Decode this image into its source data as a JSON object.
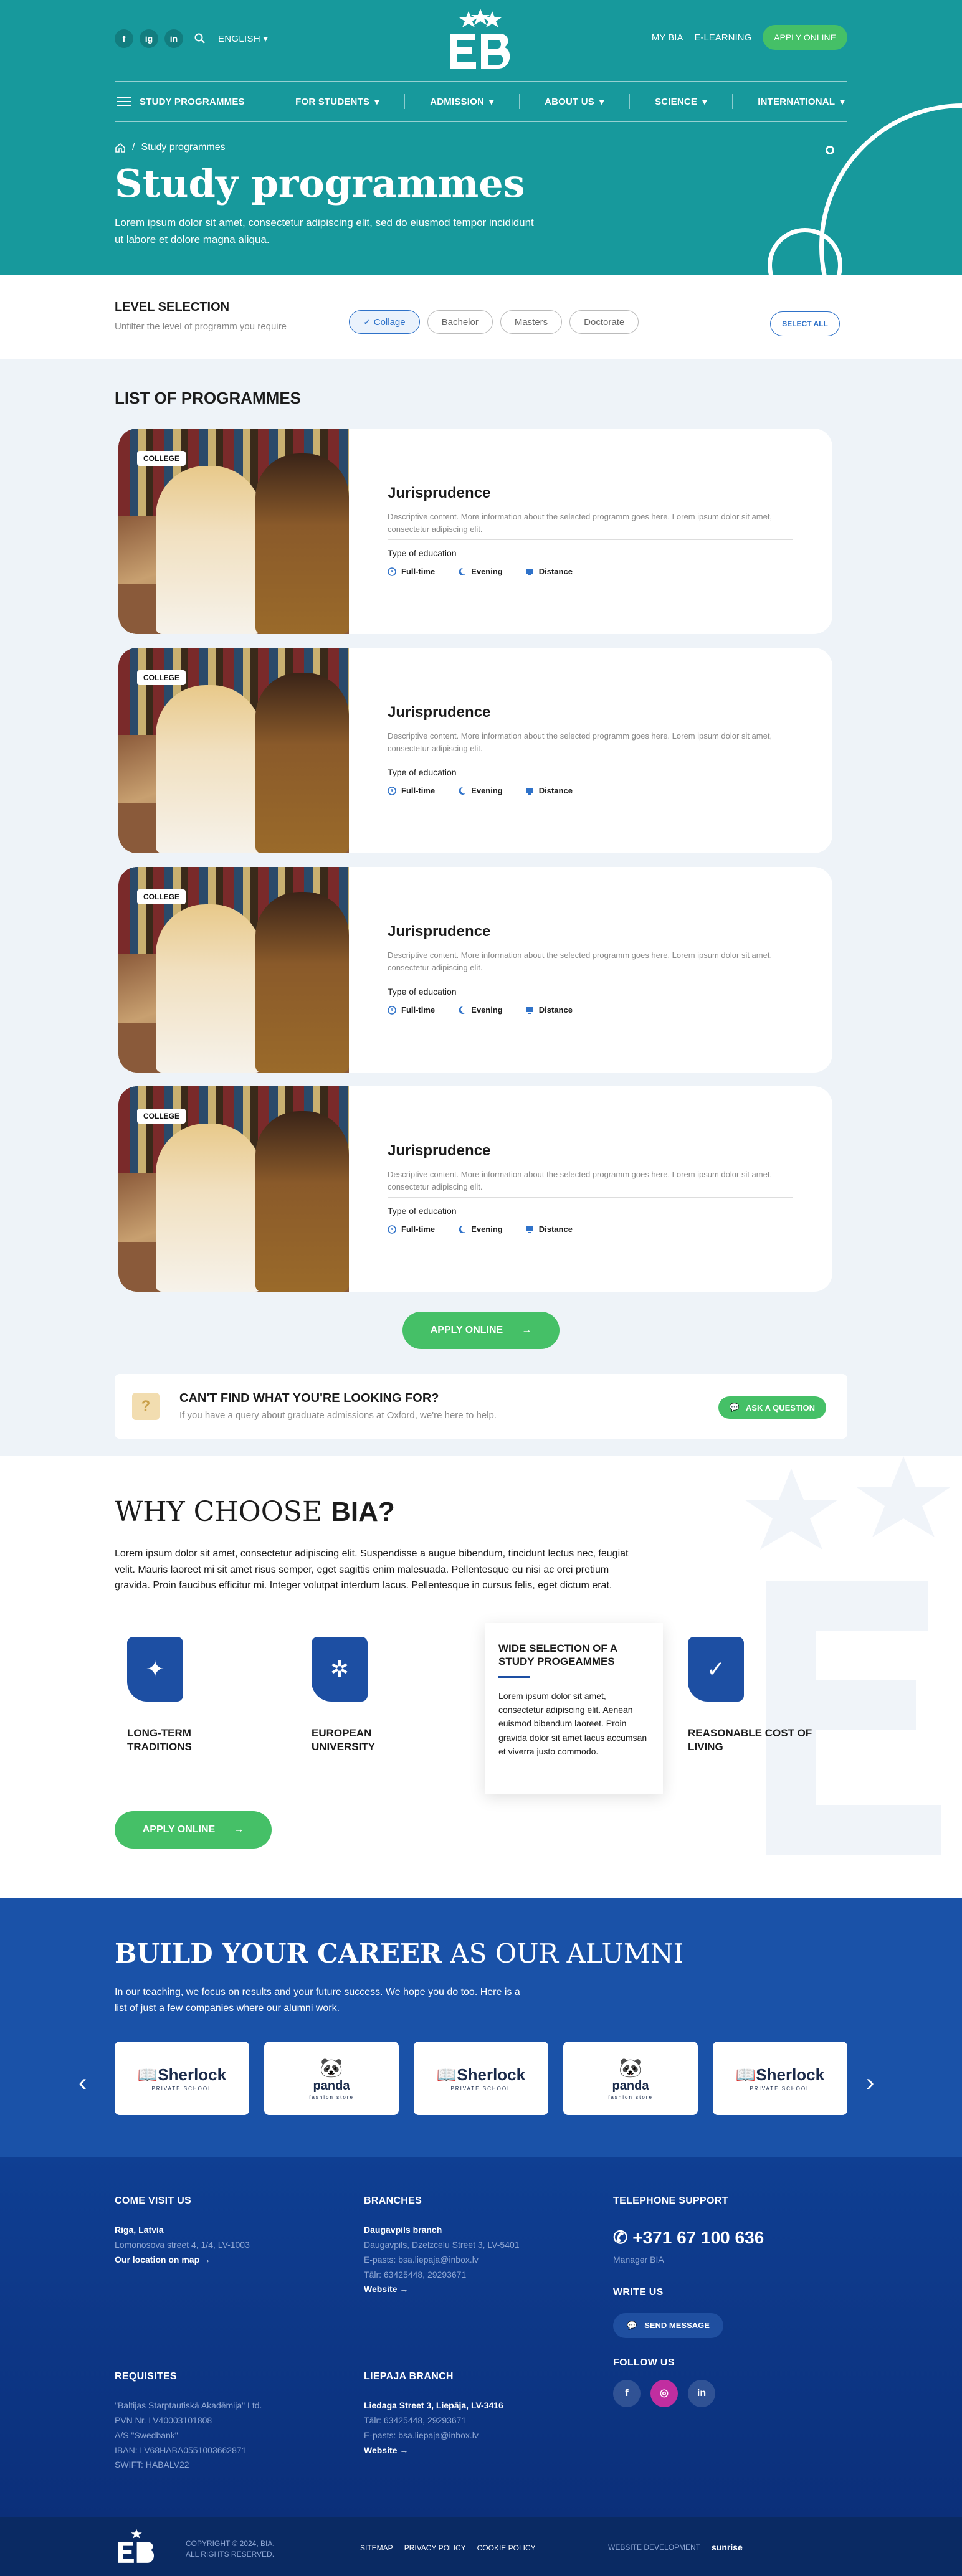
{
  "header": {
    "social": [
      "f",
      "ig",
      "in"
    ],
    "language": "ENGLISH",
    "links": [
      "MY BIA",
      "E-LEARNING"
    ],
    "apply": "APPLY ONLINE",
    "nav": [
      "STUDY PROGRAMMES",
      "FOR STUDENTS",
      "ADMISSION",
      "ABOUT US",
      "SCIENCE",
      "INTERNATIONAL"
    ],
    "breadcrumb": "Study programmes",
    "title": "Study programmes",
    "lead": "Lorem ipsum dolor sit amet, consectetur adipiscing elit, sed do eiusmod tempor incididunt ut labore et dolore magna aliqua."
  },
  "level": {
    "title": "LEVEL SELECTION",
    "subtitle": "Unfilter the level of programm you require",
    "chips": [
      "Collage",
      "Bachelor",
      "Masters",
      "Doctorate"
    ],
    "select_all": "SELECT ALL"
  },
  "list": {
    "title": "LIST OF PROGRAMMES",
    "cards": [
      {
        "badge": "COLLEGE",
        "title": "Jurisprudence",
        "desc": "Descriptive content. More information about the selected programm goes here. Lorem ipsum dolor sit amet, consectetur adipiscing elit.",
        "type_label": "Type of education",
        "types": [
          "Full-time",
          "Evening",
          "Distance"
        ]
      },
      {
        "badge": "COLLEGE",
        "title": "Jurisprudence",
        "desc": "Descriptive content. More information about the selected programm goes here. Lorem ipsum dolor sit amet, consectetur adipiscing elit.",
        "type_label": "Type of education",
        "types": [
          "Full-time",
          "Evening",
          "Distance"
        ]
      },
      {
        "badge": "COLLEGE",
        "title": "Jurisprudence",
        "desc": "Descriptive content. More information about the selected programm goes here. Lorem ipsum dolor sit amet, consectetur adipiscing elit.",
        "type_label": "Type of education",
        "types": [
          "Full-time",
          "Evening",
          "Distance"
        ]
      },
      {
        "badge": "COLLEGE",
        "title": "Jurisprudence",
        "desc": "Descriptive content. More information about the selected programm goes here. Lorem ipsum dolor sit amet, consectetur adipiscing elit.",
        "type_label": "Type of education",
        "types": [
          "Full-time",
          "Evening",
          "Distance"
        ]
      }
    ],
    "apply": "APPLY ONLINE",
    "question": {
      "title": "CAN'T FIND WHAT YOU'RE LOOKING FOR?",
      "subtitle": "If you have a query about graduate admissions at Oxford, we're here to help.",
      "button": "ASK A QUESTION"
    }
  },
  "why": {
    "title_light": "WHY CHOOSE ",
    "title_bold": "BIA?",
    "text": "Lorem ipsum dolor sit amet, consectetur adipiscing elit. Suspendisse a augue bibendum, tincidunt lectus nec, feugiat velit. Mauris laoreet mi sit amet risus semper, eget sagittis enim malesuada. Pellentesque eu nisi ac orci pretium gravida. Proin faucibus efficitur mi. Integer volutpat interdum lacus. Pellentesque in cursus felis, eget dictum erat.",
    "features": [
      "LONG-TERM TRADITIONS",
      "EUROPEAN UNIVERSITY",
      "REASONABLE COST OF LIVING"
    ],
    "card": {
      "title": "WIDE SELECTION OF A STUDY PROGEAMMES",
      "text": "Lorem ipsum dolor sit amet, consectetur adipiscing elit. Aenean euismod bibendum laoreet. Proin gravida dolor sit amet lacus accumsan et viverra justo commodo."
    },
    "apply": "APPLY ONLINE"
  },
  "career": {
    "title_bold": "BUILD YOUR CAREER",
    "title_light": " AS OUR ALUMNI",
    "text": "In our teaching, we focus on results and your future success. We hope you do too. Here is a list of just a few companies where our alumni work.",
    "partners": [
      {
        "name": "Sherlock",
        "tag": "PRIVATE SCHOOL"
      },
      {
        "name": "panda",
        "tag": "fashion store"
      },
      {
        "name": "Sherlock",
        "tag": "PRIVATE SCHOOL"
      },
      {
        "name": "panda",
        "tag": "fashion store"
      },
      {
        "name": "Sherlock",
        "tag": "PRIVATE SCHOOL"
      }
    ]
  },
  "footer": {
    "visit": {
      "title": "COME VISIT US",
      "city": "Riga, Latvia",
      "address": "Lomonosova street 4, 1/4, LV-1003",
      "map": "Our location on map"
    },
    "branches": {
      "title": "BRANCHES",
      "name": "Daugavpils branch",
      "address": "Daugavpils, Dzelzcelu Street 3, LV-5401",
      "email": "E-pasts: bsa.liepaja@inbox.lv",
      "tel": "Tālr: 63425448, 29293671",
      "website": "Website"
    },
    "support": {
      "title": "TELEPHONE SUPPORT",
      "phone": "+371 67 100 636",
      "manager": "Manager BIA",
      "write": "WRITE US",
      "send": "SEND MESSAGE",
      "follow": "FOLLOW US"
    },
    "requisites": {
      "title": "REQUISITES",
      "lines": [
        "\"Baltijas Starptautiskā Akadēmija\" Ltd.",
        "PVN Nr. LV40003101808",
        "A/S \"Swedbank\"",
        "IBAN: LV68HABA0551003662871",
        "SWIFT: HABALV22"
      ]
    },
    "liepaja": {
      "title": "LIEPAJA BRANCH",
      "address": "Liedaga Street 3, Liepāja, LV-3416",
      "tel": "Tālr: 63425448, 29293671",
      "email": "E-pasts: bsa.liepaja@inbox.lv",
      "website": "Website"
    }
  },
  "bottom": {
    "copy1": "COPYRIGHT © 2024, BIA.",
    "copy2": "ALL RIGHTS RESERVED.",
    "links": [
      "SITEMAP",
      "PRIVACY POLICY",
      "COOKIE POLICY"
    ],
    "dev": "WEBSITE DEVELOPMENT",
    "dev_brand": "sunrise"
  },
  "colors": {
    "teal": "#17999c",
    "green": "#45c067",
    "blue": "#1a52a8",
    "navy": "#0b2f7a"
  }
}
